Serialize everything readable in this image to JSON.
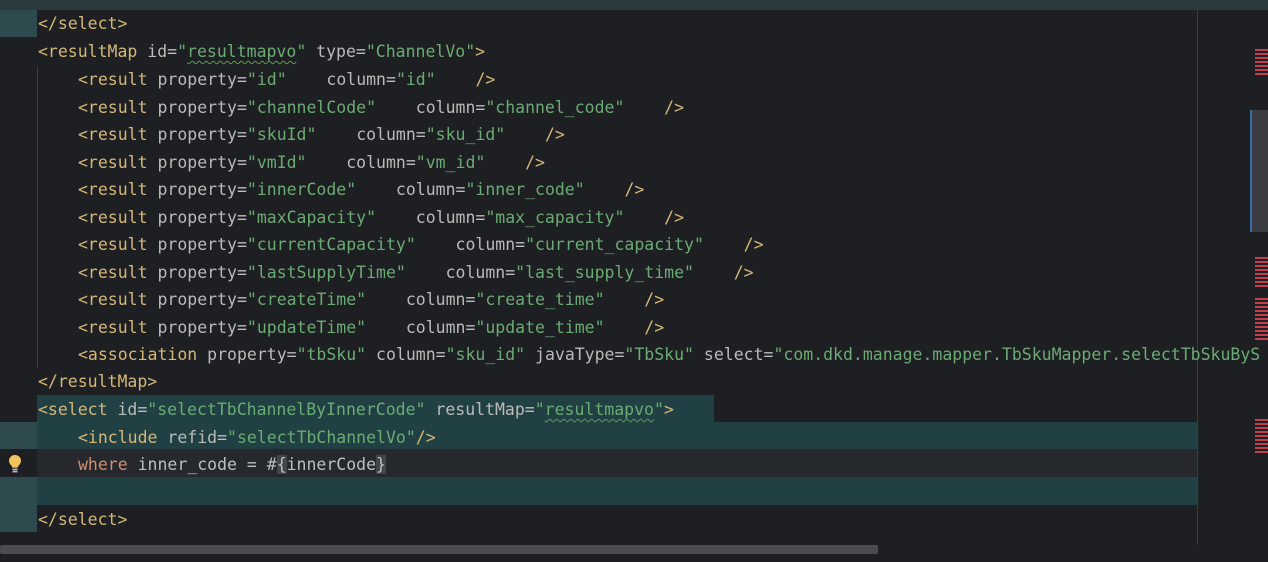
{
  "editor": {
    "lines": {
      "select_close_1": "</select>",
      "resultmap_open": {
        "tag": "<resultMap",
        "id_attr": " id",
        "id_val_q1": "\"",
        "id_val": "resultmapvo",
        "id_val_q2": "\"",
        "type_attr": " type",
        "type_val": "\"ChannelVo\"",
        "close": ">"
      },
      "results": [
        {
          "property": "\"id\"",
          "gap1": "    ",
          "column": "\"id\"",
          "gap2": "    "
        },
        {
          "property": "\"channelCode\"",
          "gap1": "    ",
          "column": "\"channel_code\"",
          "gap2": "    "
        },
        {
          "property": "\"skuId\"",
          "gap1": "    ",
          "column": "\"sku_id\"",
          "gap2": "    "
        },
        {
          "property": "\"vmId\"",
          "gap1": "    ",
          "column": "\"vm_id\"",
          "gap2": "    "
        },
        {
          "property": "\"innerCode\"",
          "gap1": "    ",
          "column": "\"inner_code\"",
          "gap2": "    "
        },
        {
          "property": "\"maxCapacity\"",
          "gap1": "    ",
          "column": "\"max_capacity\"",
          "gap2": "    "
        },
        {
          "property": "\"currentCapacity\"",
          "gap1": "    ",
          "column": "\"current_capacity\"",
          "gap2": "    "
        },
        {
          "property": "\"lastSupplyTime\"",
          "gap1": "    ",
          "column": "\"last_supply_time\"",
          "gap2": "    "
        },
        {
          "property": "\"createTime\"",
          "gap1": "    ",
          "column": "\"create_time\"",
          "gap2": "    "
        },
        {
          "property": "\"updateTime\"",
          "gap1": "    ",
          "column": "\"update_time\"",
          "gap2": "    "
        }
      ],
      "result_tag": "<result",
      "property_attr": " property",
      "column_attr": "column",
      "selfclose": "/>",
      "equals": "=",
      "association": {
        "tag": "<association",
        "property_attr": " property",
        "property_val": "\"tbSku\"",
        "column_attr": " column",
        "column_val": "\"sku_id\"",
        "javatype_attr": " javaType",
        "javatype_val": "\"TbSku\"",
        "select_attr": " select",
        "select_val": "\"com.dkd.manage.mapper.TbSkuMapper.selectTbSkuByS"
      },
      "resultmap_close": "</resultMap>",
      "select_open": {
        "tag": "<select",
        "id_attr": " id",
        "id_val": "\"selectTbChannelByInnerCode\"",
        "resultmap_attr": " resultMap",
        "rm_q1": "\"",
        "rm_val": "resultmapvo",
        "rm_q2": "\"",
        "close": ">"
      },
      "include": {
        "tag": "<include",
        "refid_attr": " refid",
        "refid_val": "\"selectTbChannelVo\"",
        "close": "/>"
      },
      "where": {
        "keyword": "where",
        "rest": " inner_code = ",
        "hash": "#",
        "open_brace": "{",
        "param": "innerCode",
        "close_brace": "}"
      },
      "select_close_2": "</select>"
    }
  },
  "colors": {
    "background": "#1e1f22",
    "tag": "#d5b778",
    "string": "#6aab73",
    "keyword": "#cf8e6d",
    "text": "#bcbec4",
    "selection_band": "#214043",
    "error_stripe": "#c2404b"
  },
  "icons": {
    "intention": "lightbulb-icon"
  }
}
